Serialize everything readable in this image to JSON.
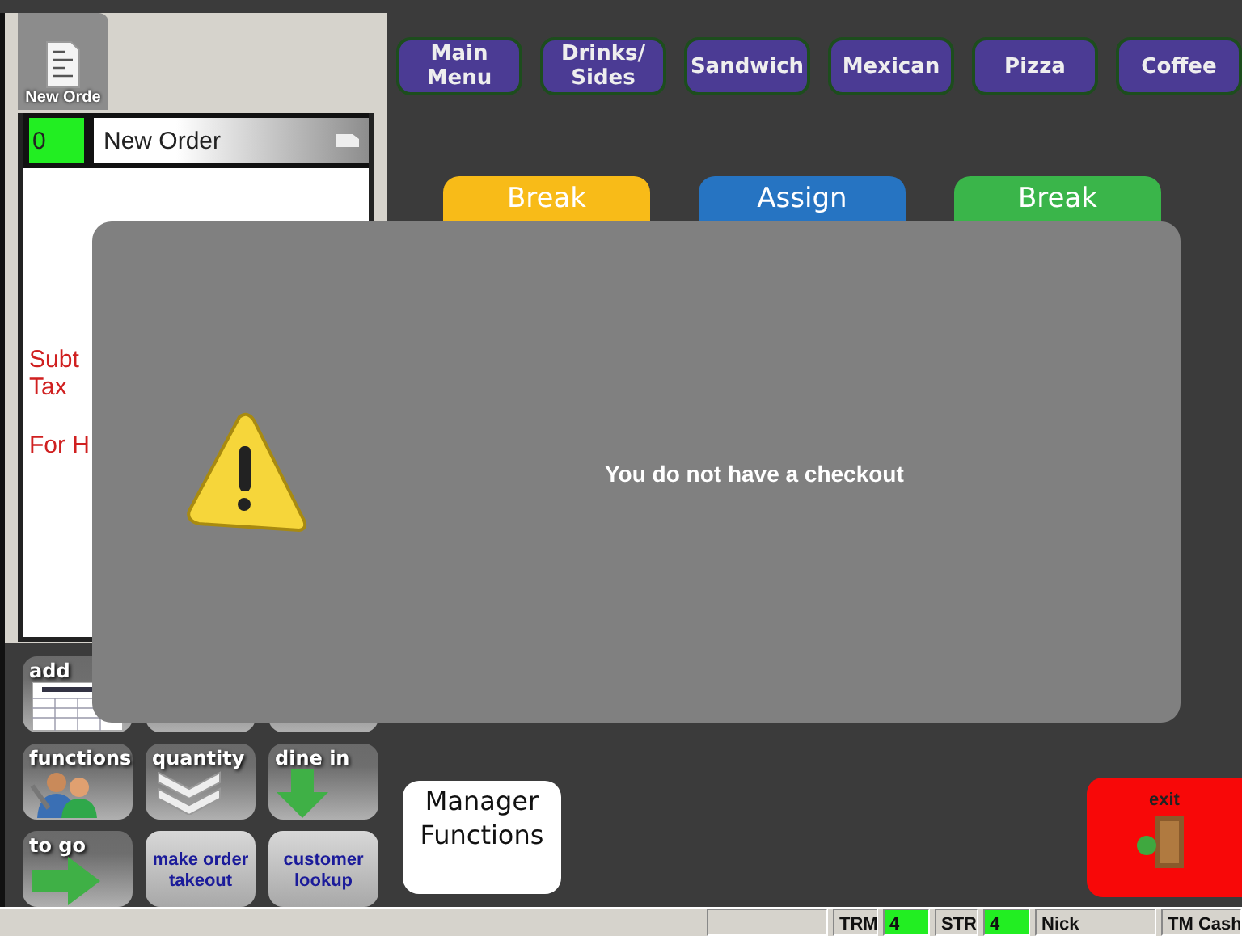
{
  "document_tab": {
    "label": "New Orde"
  },
  "order": {
    "number": "0",
    "title": "New Order",
    "totals": [
      "Subt",
      "Tax"
    ],
    "footer": "For H"
  },
  "order_buttons": [
    {
      "kind": "add",
      "label": "add"
    },
    {
      "kind": "covered"
    },
    {
      "kind": "covered"
    },
    {
      "kind": "functions",
      "label": "functions"
    },
    {
      "kind": "quantity",
      "label": "quantity"
    },
    {
      "kind": "dine_in",
      "label": "dine in"
    },
    {
      "kind": "to_go",
      "label": "to go"
    },
    {
      "kind": "text",
      "label": "make order takeout"
    },
    {
      "kind": "text",
      "label": "customer lookup"
    }
  ],
  "categories": [
    "Main Menu",
    "Drinks/ Sides",
    "Sandwich",
    "Mexican",
    "Pizza",
    "Coffee"
  ],
  "actions": [
    {
      "label": "Break",
      "color": "#f8bb18"
    },
    {
      "label": "Assign",
      "color": "#2674c2"
    },
    {
      "label": "Break",
      "color": "#3ab54a"
    }
  ],
  "manager_button": {
    "label": "Manager Functions"
  },
  "exit_button": {
    "label": "exit"
  },
  "dialog": {
    "message": "You do not have a checkout"
  },
  "status_bar": {
    "terminal_label": "TRM",
    "terminal": "4",
    "store_label": "STR",
    "store": "4",
    "user": "Nick",
    "role": "TM Cash"
  }
}
